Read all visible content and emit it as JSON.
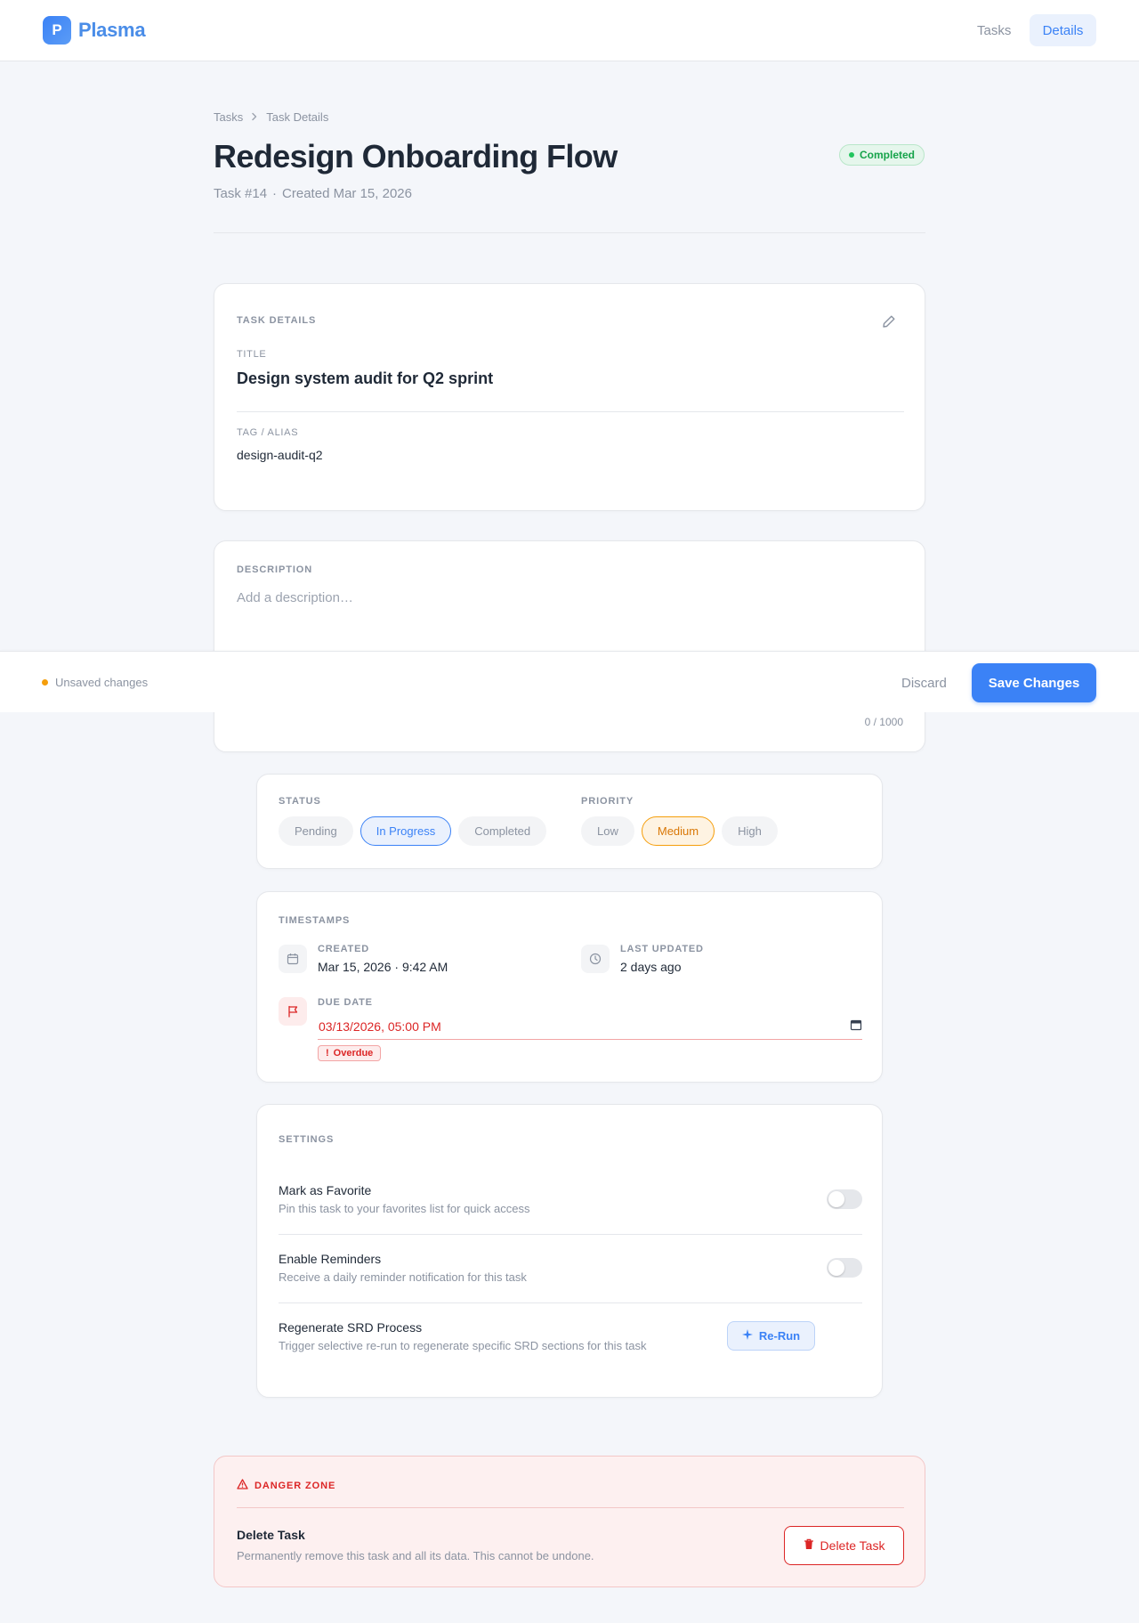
{
  "app": {
    "logo_letter": "P",
    "name": "Plasma"
  },
  "nav": {
    "tasks": "Tasks",
    "details": "Details"
  },
  "breadcrumb": {
    "root": "Tasks",
    "current": "Task Details"
  },
  "header": {
    "title": "Redesign Onboarding Flow",
    "task_id": "Task #14",
    "separator": "·",
    "created": "Created Mar 15, 2026",
    "status_badge": "Completed"
  },
  "details_card": {
    "section_label": "Task Details",
    "title_label": "Title",
    "title_value": "Design system audit for Q2 sprint",
    "tag_label": "Tag / Alias",
    "tag_value": "design-audit-q2",
    "edit_icon": "pencil-icon"
  },
  "description": {
    "section_label": "Description",
    "placeholder": "Add a description…",
    "value": "",
    "char_count": "0 / 1000"
  },
  "status": {
    "label": "Status",
    "options": [
      "Pending",
      "In Progress",
      "Completed"
    ],
    "selected": "In Progress"
  },
  "priority": {
    "label": "Priority",
    "options": [
      "Low",
      "Medium",
      "High"
    ],
    "selected": "Medium"
  },
  "timestamps": {
    "section_label": "Timestamps",
    "created_label": "Created",
    "created_value": "Mar 15, 2026 · 9:42 AM",
    "updated_label": "Last Updated",
    "updated_value": "2 days ago",
    "due_label": "Due Date",
    "due_value": "03/13/2026, 05:00 PM",
    "overdue_badge": "Overdue"
  },
  "settings": {
    "section_label": "Settings",
    "favorite_title": "Mark as Favorite",
    "favorite_desc": "Pin this task to your favorites list for quick access",
    "favorite_on": false,
    "reminders_title": "Enable Reminders",
    "reminders_desc": "Receive a daily reminder notification for this task",
    "reminders_on": false,
    "srd_title": "Regenerate SRD Process",
    "srd_desc": "Trigger selective re-run to regenerate specific SRD sections for this task",
    "rerun_label": "Re-Run"
  },
  "danger": {
    "section_label": "DANGER ZONE",
    "title": "Delete Task",
    "desc": "Permanently remove this task and all its data. This cannot be undone.",
    "delete_label": "Delete Task"
  },
  "savebar": {
    "unsaved": "Unsaved changes",
    "discard": "Discard",
    "save": "Save Changes"
  },
  "colors": {
    "accent": "#3b82f6",
    "success": "#16a34a",
    "warning": "#f59e0b",
    "danger": "#dc2626"
  }
}
